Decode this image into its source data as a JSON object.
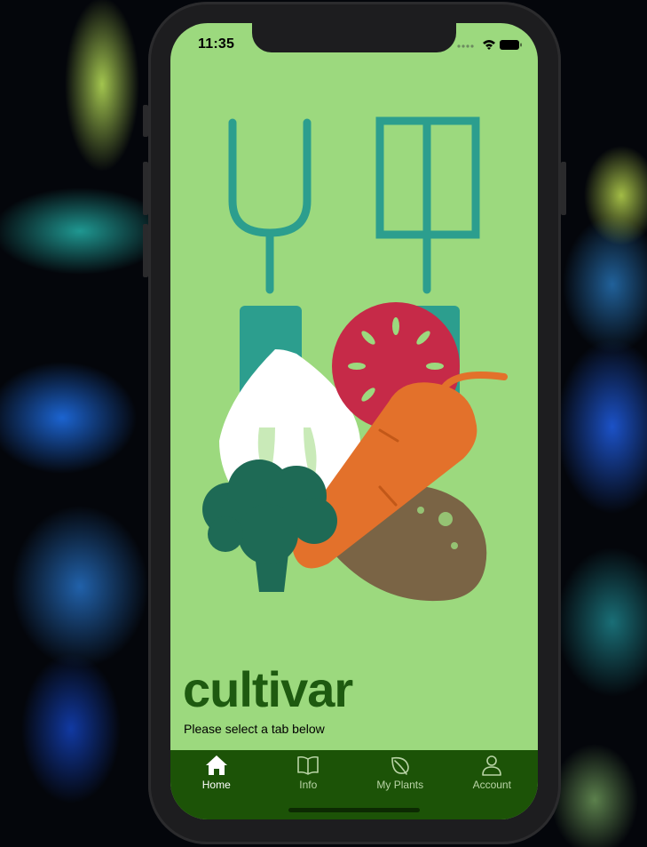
{
  "status_bar": {
    "time": "11:35",
    "icons": [
      "signal-dots-icon",
      "wifi-icon",
      "battery-icon"
    ]
  },
  "hero": {
    "illustration": "vegetables-with-garden-tools",
    "colors": {
      "tools": "#2c9e8e",
      "garlic": "#ffffff",
      "tomato": "#c62a48",
      "carrot": "#e3712b",
      "potato": "#7a6445",
      "broccoli": "#1e6a55"
    }
  },
  "app": {
    "name": "cultivar",
    "subtitle": "Please select a tab below"
  },
  "tabs": [
    {
      "label": "Home",
      "icon": "house-icon",
      "active": true
    },
    {
      "label": "Info",
      "icon": "book-icon",
      "active": false
    },
    {
      "label": "My Plants",
      "icon": "leaf-icon",
      "active": false
    },
    {
      "label": "Account",
      "icon": "person-icon",
      "active": false
    }
  ],
  "colors": {
    "screen_background": "#9cd97e",
    "tab_bar": "#1c5307",
    "title": "#1e5a10",
    "tab_active": "#ffffff",
    "tab_inactive": "#b9d4a6"
  }
}
